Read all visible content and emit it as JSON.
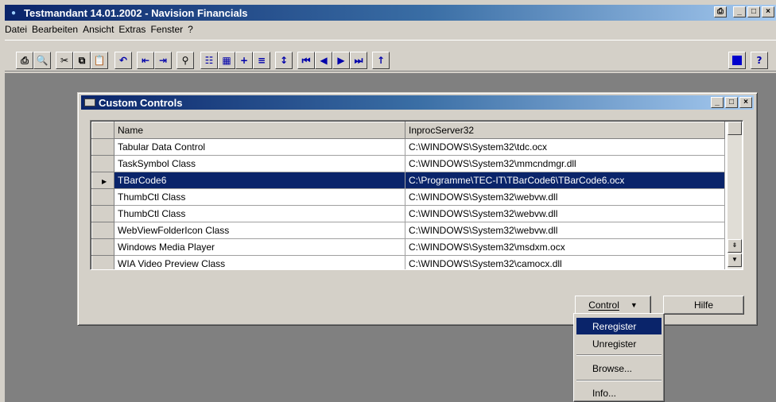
{
  "window": {
    "title": "Testmandant 14.01.2002 - Navision Financials"
  },
  "menu": [
    "Datei",
    "Bearbeiten",
    "Ansicht",
    "Extras",
    "Fenster",
    "?"
  ],
  "dialog": {
    "title": "Custom Controls",
    "columns": [
      "Name",
      "InprocServer32"
    ],
    "rows": [
      {
        "name": "Tabular Data Control",
        "path": "C:\\WINDOWS\\System32\\tdc.ocx"
      },
      {
        "name": "TaskSymbol Class",
        "path": "C:\\WINDOWS\\System32\\mmcndmgr.dll"
      },
      {
        "name": "TBarCode6",
        "path": "C:\\Programme\\TEC-IT\\TBarCode6\\TBarCode6.ocx"
      },
      {
        "name": "ThumbCtl Class",
        "path": "C:\\WINDOWS\\System32\\webvw.dll"
      },
      {
        "name": "ThumbCtl Class",
        "path": "C:\\WINDOWS\\System32\\webvw.dll"
      },
      {
        "name": "WebViewFolderIcon Class",
        "path": "C:\\WINDOWS\\System32\\webvw.dll"
      },
      {
        "name": "Windows Media Player",
        "path": "C:\\WINDOWS\\System32\\msdxm.ocx"
      },
      {
        "name": "WIA Video Preview Class",
        "path": "C:\\WINDOWS\\System32\\camocx.dll"
      }
    ],
    "selected_row": 2,
    "control_button": "Control",
    "help_button": "Hilfe"
  },
  "popup_menu": {
    "items": [
      "Reregister",
      "Unregister",
      "Browse...",
      "Info..."
    ],
    "highlighted": "Reregister"
  },
  "colors": {
    "title_active": "#0a246a",
    "face": "#d4d0c8",
    "workspace": "#808080",
    "selection": "#0a246a"
  }
}
